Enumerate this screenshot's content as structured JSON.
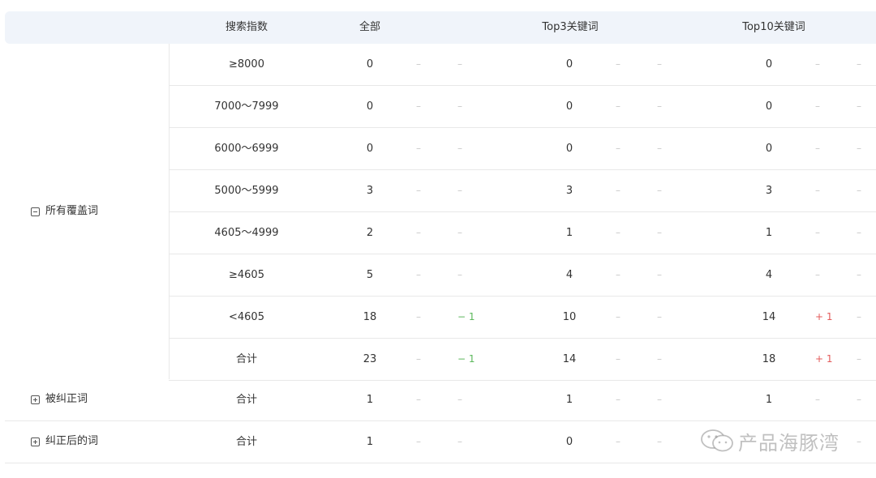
{
  "header": {
    "search_index": "搜索指数",
    "all": "全部",
    "top3": "Top3关键词",
    "top10": "Top10关键词"
  },
  "groups": {
    "all_words": "所有覆盖词",
    "corrected": "被纠正词",
    "after_corrected": "纠正后的词"
  },
  "dash": "–",
  "rows": [
    {
      "range": "≥8000",
      "all": "0",
      "all_c1": "–",
      "all_c2": "–",
      "top3": "0",
      "top3_c1": "–",
      "top3_c2": "–",
      "top10": "0",
      "top10_c1": "–",
      "top10_c2": "–"
    },
    {
      "range": "7000～7999",
      "all": "0",
      "all_c1": "–",
      "all_c2": "–",
      "top3": "0",
      "top3_c1": "–",
      "top3_c2": "–",
      "top10": "0",
      "top10_c1": "–",
      "top10_c2": "–"
    },
    {
      "range": "6000～6999",
      "all": "0",
      "all_c1": "–",
      "all_c2": "–",
      "top3": "0",
      "top3_c1": "–",
      "top3_c2": "–",
      "top10": "0",
      "top10_c1": "–",
      "top10_c2": "–"
    },
    {
      "range": "5000～5999",
      "all": "3",
      "all_c1": "–",
      "all_c2": "–",
      "top3": "3",
      "top3_c1": "–",
      "top3_c2": "–",
      "top10": "3",
      "top10_c1": "–",
      "top10_c2": "–"
    },
    {
      "range": "4605～4999",
      "all": "2",
      "all_c1": "–",
      "all_c2": "–",
      "top3": "1",
      "top3_c1": "–",
      "top3_c2": "–",
      "top10": "1",
      "top10_c1": "–",
      "top10_c2": "–"
    },
    {
      "range": "≥4605",
      "all": "5",
      "all_c1": "–",
      "all_c2": "–",
      "top3": "4",
      "top3_c1": "–",
      "top3_c2": "–",
      "top10": "4",
      "top10_c1": "–",
      "top10_c2": "–"
    },
    {
      "range": "<4605",
      "all": "18",
      "all_c1": "–",
      "all_c2": "− 1",
      "top3": "10",
      "top3_c1": "–",
      "top3_c2": "–",
      "top10": "14",
      "top10_c1": "+ 1",
      "top10_c2": "–"
    },
    {
      "range": "合计",
      "all": "23",
      "all_c1": "–",
      "all_c2": "− 1",
      "top3": "14",
      "top3_c1": "–",
      "top3_c2": "–",
      "top10": "18",
      "top10_c1": "+ 1",
      "top10_c2": "–"
    }
  ],
  "corrected_row": {
    "range": "合计",
    "all": "1",
    "all_c1": "–",
    "all_c2": "–",
    "top3": "1",
    "top3_c1": "–",
    "top3_c2": "–",
    "top10": "1",
    "top10_c1": "–",
    "top10_c2": "–"
  },
  "after_row": {
    "range": "合计",
    "all": "1",
    "all_c1": "–",
    "all_c2": "–",
    "top3": "0",
    "top3_c1": "–",
    "top3_c2": "–",
    "top10_c2": "–"
  },
  "watermark": "产品海豚湾",
  "colors": {
    "header_bg": "#f0f4fa",
    "negative": "#5cb85c",
    "positive": "#e35b5b",
    "dash": "#c8c8c8"
  }
}
